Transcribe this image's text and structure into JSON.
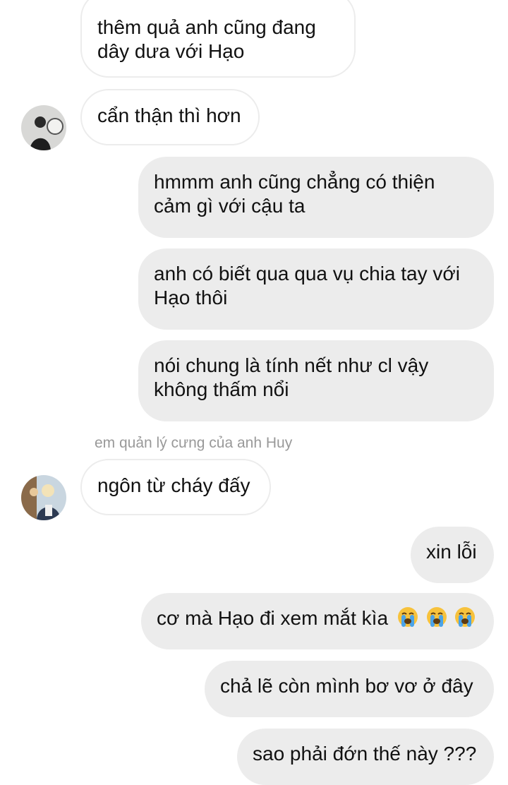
{
  "messages": [
    {
      "side": "incoming",
      "lines": [
        "thêm quả anh cũng đang",
        "dây dưa với Hạo"
      ]
    },
    {
      "side": "incoming",
      "lines": [
        "cẩn thận thì hơn"
      ]
    },
    {
      "side": "outgoing",
      "lines": [
        "hmmm anh cũng chẳng có thiện",
        "cảm gì với cậu ta"
      ]
    },
    {
      "side": "outgoing",
      "lines": [
        "anh có biết qua qua vụ chia tay với",
        "Hạo thôi"
      ]
    },
    {
      "side": "outgoing",
      "lines": [
        "nói chung là tính nết như cl vậy",
        "không thấm nổi"
      ]
    },
    {
      "side": "incoming",
      "lines": [
        "ngôn từ cháy đấy"
      ]
    },
    {
      "side": "outgoing",
      "lines": [
        "xin lỗi"
      ]
    },
    {
      "side": "outgoing",
      "lines": [
        "cơ mà Hạo đi xem mắt kìa"
      ],
      "emoji": [
        "loudly-crying-face",
        "loudly-crying-face",
        "loudly-crying-face"
      ]
    },
    {
      "side": "outgoing",
      "lines": [
        "chả lẽ còn mình bơ vơ ở đây"
      ]
    },
    {
      "side": "outgoing",
      "lines": [
        "sao phải đớn thế này ???"
      ]
    }
  ],
  "sender_label": "em quản lý cưng của anh Huy",
  "colors": {
    "outgoing_bubble": "#ececec",
    "incoming_border": "#ececec",
    "sender_text": "#999999"
  }
}
